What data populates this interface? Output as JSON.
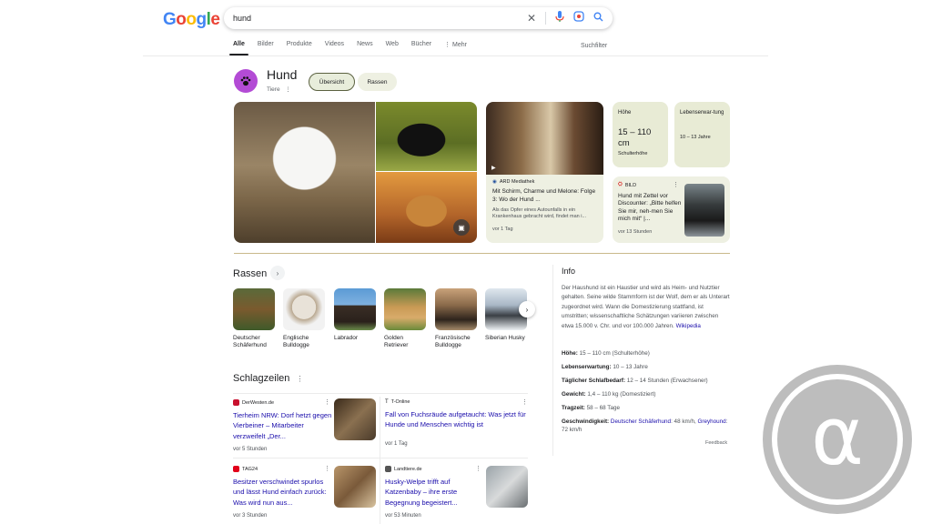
{
  "header": {
    "logo_letters": [
      "G",
      "o",
      "o",
      "g",
      "l",
      "e"
    ],
    "search_value": "hund",
    "tabs": [
      "Alle",
      "Bilder",
      "Produkte",
      "Videos",
      "News",
      "Web",
      "Bücher",
      "⋮ Mehr"
    ],
    "tools_label": "Suchfilter"
  },
  "entity": {
    "title": "Hund",
    "subtitle": "Tiere",
    "chips": [
      "Übersicht",
      "Rassen"
    ]
  },
  "news_card": {
    "source": "ARD Mediathek",
    "title": "Mit Schirm, Charme und Melone: Folge 3: Wo der Hund ...",
    "description": "Als das Opfer eines Autounfalls in ein Krankenhaus gebracht wird, findet man i...",
    "time": "vor 1 Tag"
  },
  "facts": {
    "height_label": "Höhe",
    "height_value": "15 – 110 cm",
    "height_sub": "Schulterhöhe",
    "life_label": "Lebenserwar-tung",
    "life_sub": "10 – 13 Jahre"
  },
  "bild_card": {
    "source": "BILD",
    "title": "Hund mit Zettel vor Discounter: „Bitte helfen Sie mir, neh-men Sie mich mit“ |...",
    "time": "vor 13 Stunden"
  },
  "breeds": {
    "title": "Rassen",
    "items": [
      {
        "name": "Deutscher Schäferhund",
        "color": "#7a5a2e"
      },
      {
        "name": "Englische Bulldogge",
        "color": "#d9d2c8"
      },
      {
        "name": "Labrador",
        "color": "#3a2e26"
      },
      {
        "name": "Golden Retriever",
        "color": "#c99a55"
      },
      {
        "name": "Französische Bulldogge",
        "color": "#8a6a4a"
      },
      {
        "name": "Siberian Husky",
        "color": "#a9b7c6"
      }
    ]
  },
  "headlines": {
    "title": "Schlagzeilen",
    "items": [
      {
        "source": "DerWesten.de",
        "title": "Tierheim NRW: Dorf hetzt gegen Vierbeiner – Mitarbeiter verzweifelt „Der...",
        "time": "vor 5 Stunden",
        "fav_color": "#c8102e"
      },
      {
        "source": "T-Online",
        "title": "Fall von Fuchsräude aufgetaucht: Was jetzt für Hunde und Menschen wichtig ist",
        "time": "vor 1 Tag",
        "fav_color": "#e4007c"
      },
      {
        "source": "TAG24",
        "title": "Besitzer verschwindet spurlos und lässt Hund einfach zurück: Was wird nun aus...",
        "time": "vor 3 Stunden",
        "fav_color": "#e2001a"
      },
      {
        "source": "Landtiere.de",
        "title": "Husky-Welpe trifft auf Katzenbaby – ihre erste Begegnung begeistert...",
        "time": "vor 53 Minuten",
        "fav_color": "#555555"
      }
    ]
  },
  "info": {
    "title": "Info",
    "text": "Der Haushund ist ein Haustier und wird als Heim- und Nutztier gehalten. Seine wilde Stammform ist der Wolf, dem er als Unterart zugeordnet wird. Wann die Domestizierung stattfand, ist umstritten; wissenschaftliche Schätzungen variieren zwischen etwa 15.000 v. Chr. und vor 100.000 Jahren.",
    "source_link": "Wikipedia",
    "rows": [
      {
        "label": "Höhe:",
        "value": "15 – 110 cm (Schulterhöhe)"
      },
      {
        "label": "Lebenserwartung:",
        "value": "10 – 13 Jahre"
      },
      {
        "label": "Täglicher Schlafbedarf:",
        "value": "12 – 14 Stunden (Erwachsener)"
      },
      {
        "label": "Gewicht:",
        "value": "1,4 – 110 kg (Domestiziert)"
      },
      {
        "label": "Tragzeit:",
        "value": "58 – 68 Tage"
      }
    ],
    "speed_label": "Geschwindigkeit:",
    "speed_link1": "Deutscher Schäferhund",
    "speed_value1": ": 48 km/h,",
    "speed_link2": "Greyhound",
    "speed_value2": ": 72 km/h",
    "feedback": "Feedback"
  },
  "watermark": {
    "symbol": "α",
    "color": "#b9b9b9"
  }
}
